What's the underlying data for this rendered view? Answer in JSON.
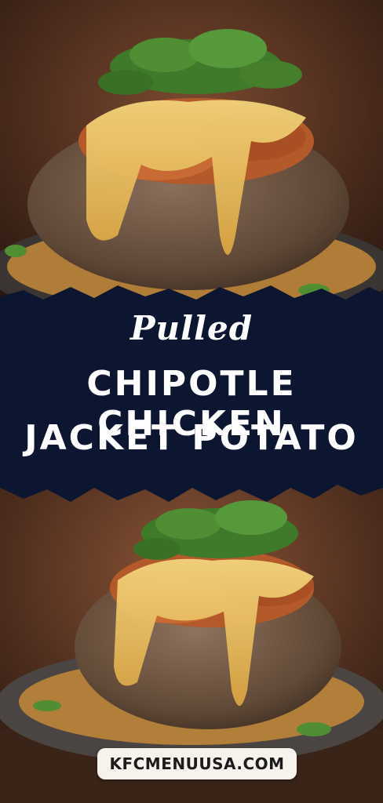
{
  "title": {
    "script": "Pulled",
    "line1": "CHIPOTLE CHICKEN",
    "line2": "JACKET POTATO"
  },
  "website": "KFCMENUUSA.COM",
  "colors": {
    "banner": "#0d1630",
    "title_text": "#ffffff",
    "badge_bg": "#f7f3ec"
  }
}
